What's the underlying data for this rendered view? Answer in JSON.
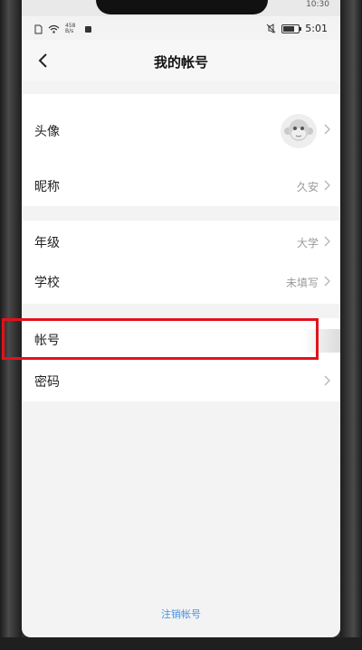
{
  "status_bar": {
    "net_speed_line1": "458",
    "net_speed_line2": "B/s",
    "time": "5:01",
    "top_clock": "10:30"
  },
  "header": {
    "title": "我的帐号"
  },
  "profile": {
    "avatar_label": "头像",
    "nickname_label": "昵称",
    "nickname_value": "久安"
  },
  "school_info": {
    "grade_label": "年级",
    "grade_value": "大学",
    "school_label": "学校",
    "school_value": "未填写"
  },
  "account": {
    "account_label": "帐号",
    "password_label": "密码"
  },
  "footer": {
    "logout_label": "注销帐号"
  },
  "colors": {
    "highlight": "#e2121b",
    "link": "#4a90e2"
  },
  "icons": [
    "back-arrow-icon",
    "chevron-right-icon",
    "wifi-icon",
    "mute-icon",
    "battery-icon"
  ]
}
